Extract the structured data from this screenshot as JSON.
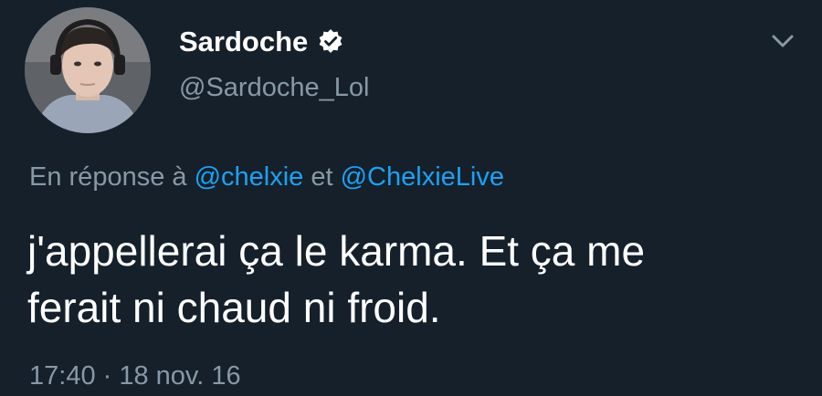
{
  "author": {
    "name": "Sardoche",
    "handle": "@Sardoche_Lol",
    "verified": true,
    "avatar_icon": "profile-photo"
  },
  "reply": {
    "prefix": "En réponse à ",
    "mention_1": "@chelxie",
    "connector": " et ",
    "mention_2": "@ChelxieLive"
  },
  "tweet": {
    "text": "j'appellerai ça le karma. Et ça me\nferait ni chaud ni froid."
  },
  "meta": {
    "time": "17:40",
    "separator": " · ",
    "date": "18 nov. 16"
  },
  "icons": {
    "verified": "verified-badge-icon",
    "menu": "chevron-down-icon"
  },
  "colors": {
    "background": "#15202b",
    "text": "#ffffff",
    "secondary": "#8899a6",
    "link": "#1da1f2"
  }
}
